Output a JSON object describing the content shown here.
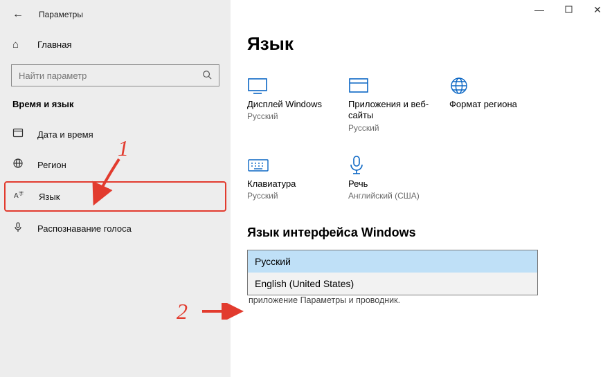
{
  "window": {
    "title": "Параметры"
  },
  "sidebar": {
    "home_label": "Главная",
    "search_placeholder": "Найти параметр",
    "section_title": "Время и язык",
    "items": [
      {
        "label": "Дата и время"
      },
      {
        "label": "Регион"
      },
      {
        "label": "Язык"
      },
      {
        "label": "Распознавание голоса"
      }
    ]
  },
  "main": {
    "page_title": "Язык",
    "tiles": [
      {
        "label": "Дисплей Windows",
        "value": "Русский"
      },
      {
        "label": "Приложения и веб-сайты",
        "value": "Русский"
      },
      {
        "label": "Формат региона",
        "value": ""
      },
      {
        "label": "Клавиатура",
        "value": "Русский"
      },
      {
        "label": "Речь",
        "value": "Английский (США)"
      }
    ],
    "section_heading": "Язык интерфейса Windows",
    "dropdown": {
      "options": [
        "Русский",
        "English (United States)"
      ],
      "selected_index": 0
    },
    "hint": "приложение  Параметры  и проводник."
  },
  "annotations": {
    "n1": "1",
    "n2": "2"
  }
}
